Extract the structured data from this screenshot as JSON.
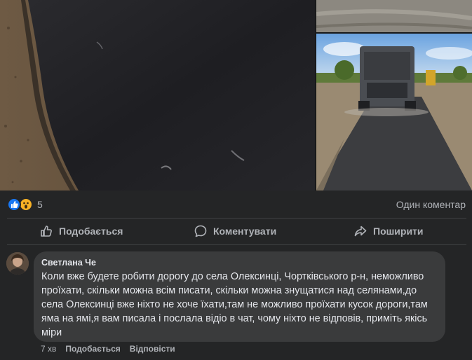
{
  "post": {
    "reactions": {
      "icons": [
        "like-icon",
        "wow-icon"
      ],
      "count": "5"
    },
    "comments_summary": "Один коментар",
    "actions": {
      "like_label": "Подобається",
      "comment_label": "Коментувати",
      "share_label": "Поширити"
    }
  },
  "comment": {
    "author": "Светлана Че",
    "text": "Коли вже будете робити дорогу до села Олексинці, Чортківського р-н, неможливо проїхати, скільки можна всім писати, скільки можна знущатися над селянами,до села Олексинці вже ніхто не хоче їхати,там не можливо проїхати кусок дороги,там яма на ямі,я вам писала і послала відіо в чат, чому ніхто не відповів, приміть якісь міри",
    "time": "7 хв",
    "like_label": "Подобається",
    "reply_label": "Відповісти"
  },
  "colors": {
    "background": "#242526",
    "bubble": "#3a3b3c",
    "secondary_text": "#b0b3b8",
    "like_blue": "#1877f2",
    "wow_yellow": "#f7b125"
  }
}
